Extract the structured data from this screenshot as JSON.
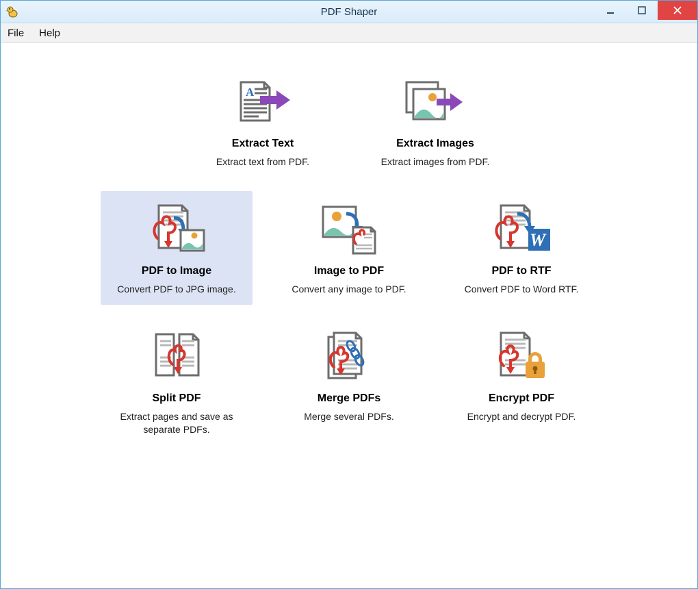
{
  "window": {
    "title": "PDF Shaper"
  },
  "menu": {
    "file": "File",
    "help": "Help"
  },
  "tiles": {
    "extract_text": {
      "title": "Extract Text",
      "desc": "Extract text from PDF."
    },
    "extract_images": {
      "title": "Extract Images",
      "desc": "Extract images from PDF."
    },
    "pdf_to_image": {
      "title": "PDF to Image",
      "desc": "Convert PDF to JPG image."
    },
    "image_to_pdf": {
      "title": "Image to PDF",
      "desc": "Convert any image to PDF."
    },
    "pdf_to_rtf": {
      "title": "PDF to RTF",
      "desc": "Convert PDF to Word RTF."
    },
    "split_pdf": {
      "title": "Split PDF",
      "desc": "Extract pages and save as separate PDFs."
    },
    "merge_pdfs": {
      "title": "Merge PDFs",
      "desc": "Merge several PDFs."
    },
    "encrypt_pdf": {
      "title": "Encrypt PDF",
      "desc": "Encrypt and decrypt PDF."
    }
  },
  "colors": {
    "title_border": "#56a7da",
    "accent_purple": "#8b48b8",
    "accent_orange": "#e9a13a",
    "accent_teal": "#77c4af",
    "accent_blue": "#2e6fb6",
    "pdf_red": "#d6362e",
    "selection_bg": "#dbe3f4",
    "close_btn": "#e04443"
  }
}
